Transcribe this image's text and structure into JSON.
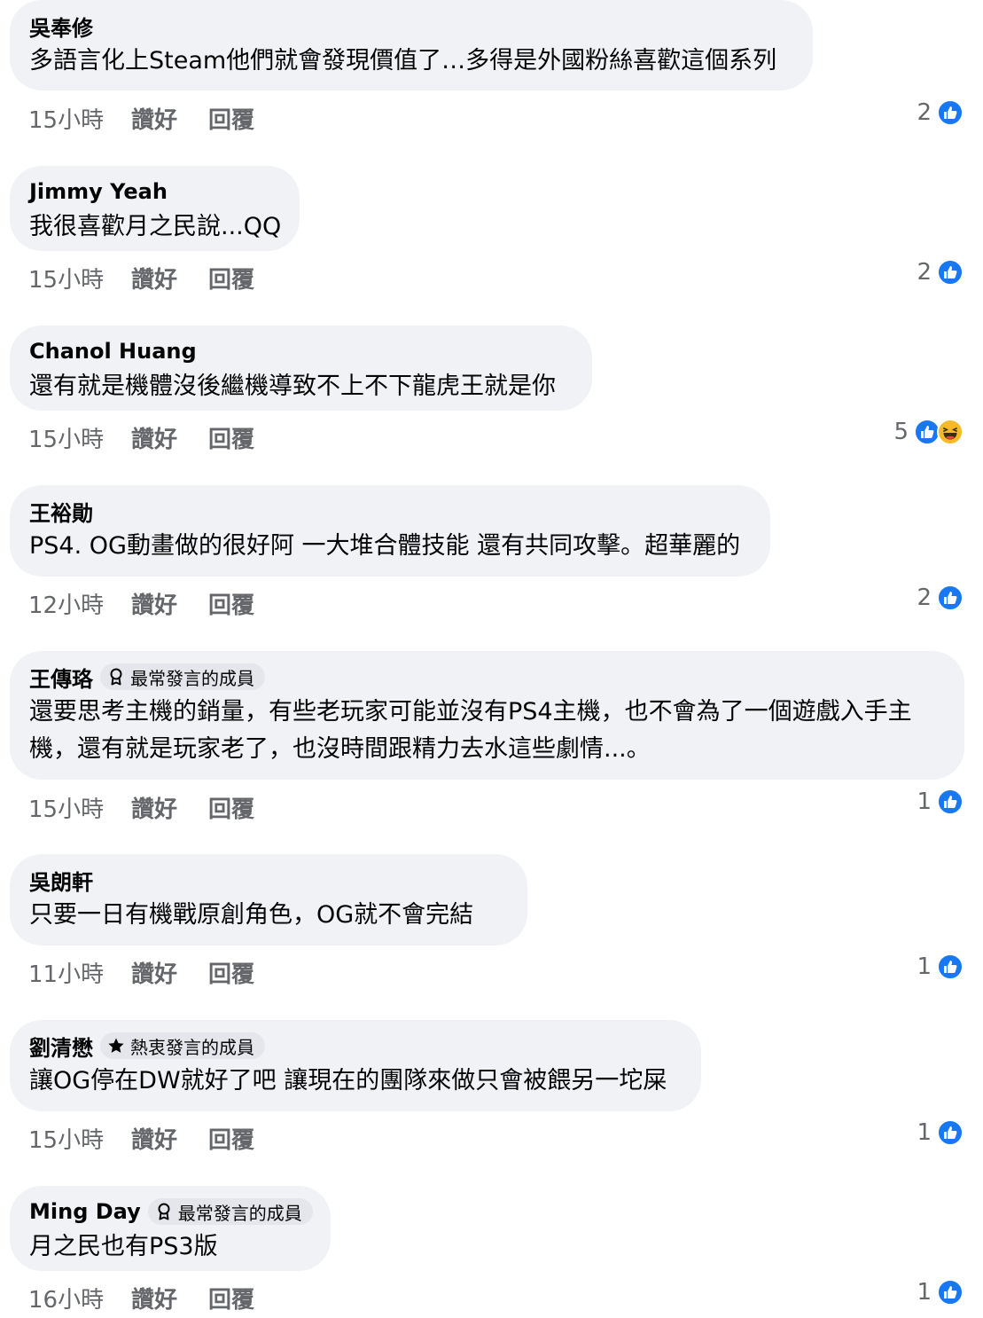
{
  "labels": {
    "like": "讚好",
    "reply": "回覆"
  },
  "comments": [
    {
      "author": "吳奉修",
      "text": "多語言化上Steam他們就會發現價值了…多得是外國粉絲喜歡這個系列",
      "time": "15小時",
      "reaction_count": "2",
      "reactions": [
        "like"
      ]
    },
    {
      "author": "Jimmy Yeah",
      "text": "我很喜歡月之民說...QQ",
      "time": "15小時",
      "reaction_count": "2",
      "reactions": [
        "like"
      ]
    },
    {
      "author": "Chanol Huang",
      "text": "還有就是機體沒後繼機導致不上不下龍虎王就是你",
      "time": "15小時",
      "reaction_count": "5",
      "reactions": [
        "like",
        "haha"
      ]
    },
    {
      "author": "王裕勛",
      "text": "PS4. OG動畫做的很好阿 一大堆合體技能 還有共同攻擊。超華麗的",
      "time": "12小時",
      "reaction_count": "2",
      "reactions": [
        "like"
      ]
    },
    {
      "author": "王傳珞",
      "badge": "最常發言的成員",
      "badge_icon": "contributor-icon",
      "text": "還要思考主機的銷量，有些老玩家可能並沒有PS4主機，也不會為了一個遊戲入手主機，還有就是玩家老了，也沒時間跟精力去水這些劇情...。",
      "time": "15小時",
      "reaction_count": "1",
      "reactions": [
        "like"
      ]
    },
    {
      "author": "吳朗軒",
      "text": "只要一日有機戰原創角色，OG￼就不會完結",
      "time": "11小時",
      "reaction_count": "1",
      "reactions": [
        "like"
      ]
    },
    {
      "author": "劉清懋",
      "badge": "熱衷發言的成員",
      "badge_icon": "star-icon",
      "text": "讓OG停在DW就好了吧  讓現在的團隊來做只會被餵另一坨屎",
      "time": "15小時",
      "reaction_count": "1",
      "reactions": [
        "like"
      ]
    },
    {
      "author": "Ming Day",
      "badge": "最常發言的成員",
      "badge_icon": "contributor-icon",
      "text": "月之民也有PS3版",
      "time": "16小時",
      "reaction_count": "1",
      "reactions": [
        "like"
      ]
    }
  ],
  "colors": {
    "bubble": "#f0f2f5",
    "badge": "#e4e6eb",
    "meta_text": "#65676b",
    "like_blue": "#1877f2",
    "haha_yellow": "#f7b928"
  }
}
